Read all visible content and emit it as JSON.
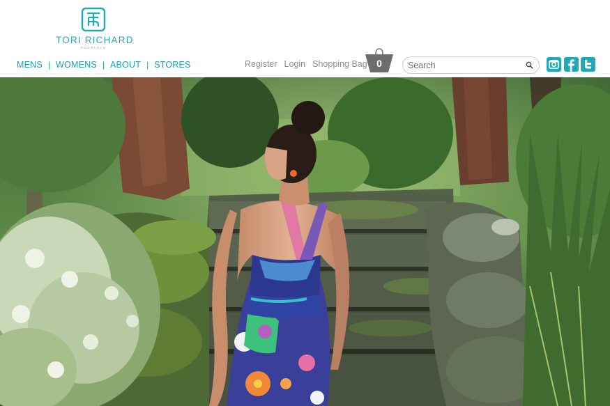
{
  "brand": {
    "name": "TORI RICHARD",
    "city": "HONOLULU",
    "accent_color": "#22a9b8"
  },
  "main_nav": {
    "items": [
      {
        "label": "MENS"
      },
      {
        "label": "WOMENS"
      },
      {
        "label": "ABOUT"
      },
      {
        "label": "STORES"
      }
    ],
    "separator": "|"
  },
  "util_nav": {
    "register": "Register",
    "login": "Login",
    "shopping_bag": "Shopping Bag"
  },
  "bag": {
    "count": "0",
    "icon": "shopping-bag-icon"
  },
  "search": {
    "placeholder": "Search",
    "value": "",
    "icon": "search-icon"
  },
  "social": [
    {
      "icon": "instagram-icon"
    },
    {
      "icon": "facebook-icon"
    },
    {
      "icon": "twitter-icon"
    }
  ],
  "hero": {
    "subject": "model-in-floral-dress-on-garden-stairs"
  }
}
